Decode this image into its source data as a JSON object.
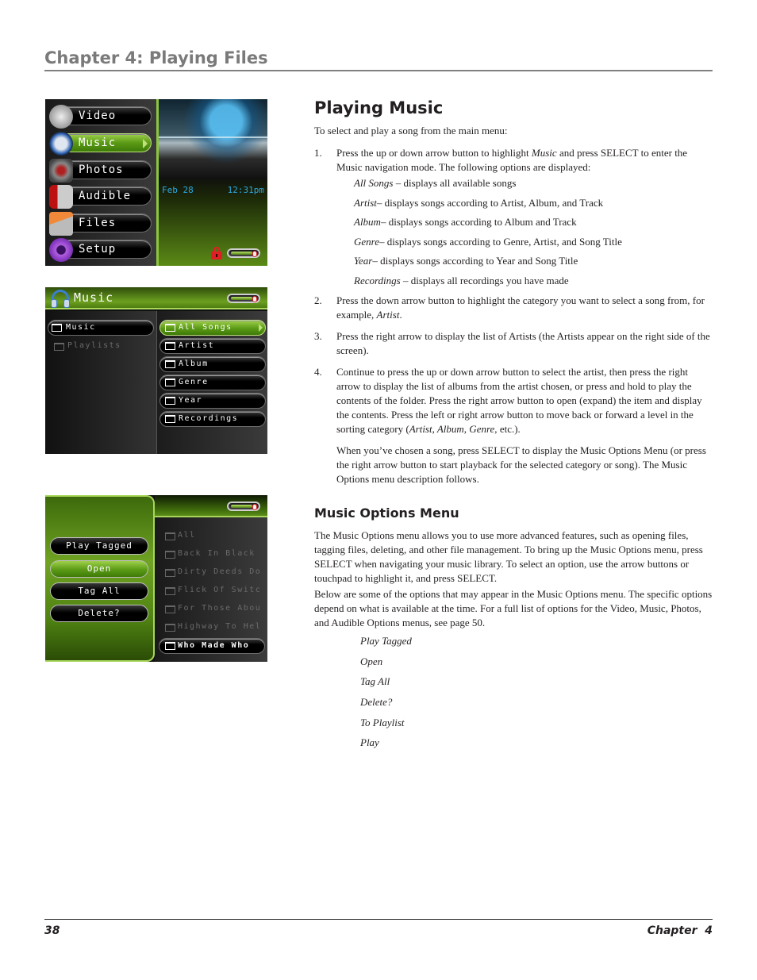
{
  "header": {
    "chapter_title": "Chapter 4: Playing Files"
  },
  "screens": {
    "main_menu": {
      "items": [
        {
          "label": "Video",
          "icon": "video-camera-icon"
        },
        {
          "label": "Music",
          "icon": "headphones-icon",
          "selected": true
        },
        {
          "label": "Photos",
          "icon": "camera-icon"
        },
        {
          "label": "Audible",
          "icon": "audible-icon"
        },
        {
          "label": "Files",
          "icon": "folder-icon"
        },
        {
          "label": "Setup",
          "icon": "gear-icon"
        }
      ],
      "date": "Feb 28",
      "time": "12:31pm",
      "status_icons": [
        "lock-icon",
        "battery-icon"
      ]
    },
    "music_browse": {
      "title": "Music",
      "left_items": [
        {
          "label": "Music",
          "selected": true
        },
        {
          "label": "Playlists",
          "dimmed": true
        }
      ],
      "right_items": [
        {
          "label": "All Songs",
          "selected": true
        },
        {
          "label": "Artist"
        },
        {
          "label": "Album"
        },
        {
          "label": "Genre"
        },
        {
          "label": "Year"
        },
        {
          "label": "Recordings"
        }
      ]
    },
    "music_options": {
      "options": [
        {
          "label": "Play Tagged"
        },
        {
          "label": "Open",
          "selected": true
        },
        {
          "label": "Tag All"
        },
        {
          "label": "Delete?"
        }
      ],
      "list_items": [
        {
          "label": "All"
        },
        {
          "label": "Back In Black"
        },
        {
          "label": "Dirty Deeds Do"
        },
        {
          "label": "Flick Of Switc"
        },
        {
          "label": "For Those Abou"
        },
        {
          "label": "Highway To Hel"
        },
        {
          "label": "Who Made Who",
          "selected": true
        }
      ]
    }
  },
  "playing_music": {
    "heading": "Playing Music",
    "intro": "To select and play a song from the main menu:",
    "steps": [
      {
        "num": "1.",
        "parts": [
          "Press the up or down arrow button to highlight ",
          "Music",
          " and press SELECT to enter the Music navigation mode. The following options are displayed:"
        ]
      },
      {
        "num": "2.",
        "parts": [
          "Press the down arrow button to highlight the category you want to select a song from, for example, ",
          "Artist",
          "."
        ]
      },
      {
        "num": "3.",
        "text": "Press the right arrow to display the list of Artists (the Artists appear on the right side of the screen)."
      },
      {
        "num": "4.",
        "parts": [
          "Continue to press the up or down arrow button to select the artist, then press the right arrow to display the list of albums from the artist chosen, or press and hold to play the contents of the folder. Press the right arrow button to open (expand) the item and display the contents. Press the left or right arrow button to move back or forward a level in the sorting category (",
          "Artist, Album, Genre,",
          " etc.)."
        ]
      }
    ],
    "categories": [
      {
        "term": "All Songs",
        "desc": " – displays all available songs"
      },
      {
        "term": "Artist",
        "desc": "– displays songs according to Artist, Album, and Track"
      },
      {
        "term": "Album",
        "desc": "– displays songs according to Album and Track"
      },
      {
        "term": "Genre",
        "desc": "– displays songs according to Genre, Artist, and Song Title"
      },
      {
        "term": "Year",
        "desc": "– displays songs according to Year and Song Title"
      },
      {
        "term": "Recordings",
        "desc": " – displays all recordings you have made"
      }
    ],
    "after_steps": "When you’ve chosen a song, press SELECT to display the Music Options Menu (or press the right arrow button to start playback for the selected category or song). The Music Options menu description follows."
  },
  "music_options_menu": {
    "heading": "Music Options Menu",
    "para1": "The Music Options menu allows you to use more advanced features, such as opening files, tagging files, deleting, and other file management. To bring up the Music Options menu, press SELECT when navigating your music library. To select an option, use the arrow buttons or touchpad to highlight it, and press SELECT.",
    "para2": "Below are some of the options that may appear in the Music Options menu.  The specific options depend on what is available at the time. For a full list of options for the Video, Music, Photos, and Audible Options menus, see page 50.",
    "options": [
      "Play Tagged",
      "Open",
      "Tag All",
      "Delete?",
      "To Playlist",
      "Play"
    ]
  },
  "footer": {
    "page_number": "38",
    "chapter": "Chapter  4"
  },
  "colors": {
    "accent_green": "#8cc63f",
    "time_blue": "#2ba8e0",
    "lock_red": "#e01e25",
    "header_gray": "#7a7a7a"
  }
}
